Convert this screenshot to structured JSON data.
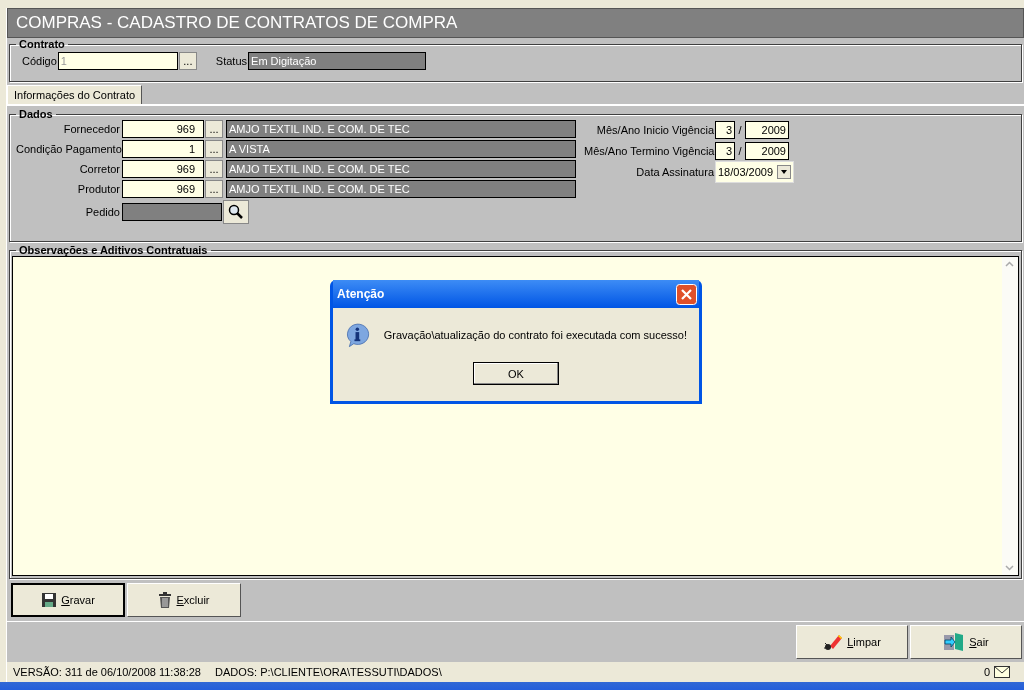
{
  "title": "COMPRAS - CADASTRO DE CONTRATOS DE COMPRA",
  "contrato": {
    "legend": "Contrato",
    "codigo_label": "Código",
    "codigo_value": "1",
    "lookup": "...",
    "status_label": "Status",
    "status_value": "Em Digitação"
  },
  "tabs": [
    {
      "label": "Informações do Contrato",
      "selected": true
    }
  ],
  "dados": {
    "legend": "Dados",
    "lookups": [
      {
        "label": "Fornecedor",
        "code": "969",
        "button": "...",
        "description": "AMJO TEXTIL IND. E COM. DE TEC"
      },
      {
        "label": "Condição Pagamento",
        "code": "1",
        "button": "...",
        "description": "A VISTA"
      },
      {
        "label": "Corretor",
        "code": "969",
        "button": "...",
        "description": "AMJO TEXTIL IND. E COM. DE TEC"
      },
      {
        "label": "Produtor",
        "code": "969",
        "button": "...",
        "description": "AMJO TEXTIL IND. E COM. DE TEC"
      }
    ],
    "pedido_label": "Pedido",
    "periods": [
      {
        "label": "Mês/Ano Inicio Vigência",
        "month": "3",
        "separator": "/",
        "year": "2009"
      },
      {
        "label": "Mês/Ano Termino Vigência",
        "month": "3",
        "separator": "/",
        "year": "2009"
      }
    ],
    "signature": {
      "label": "Data Assinatura",
      "value": "18/03/2009"
    }
  },
  "observacoes": {
    "legend": "Observações e Aditivos Contratuais"
  },
  "actions": [
    {
      "label": "Gravar",
      "kind": "save",
      "focused": true
    },
    {
      "label": "Excluir",
      "kind": "trash",
      "focused": false
    }
  ],
  "bottom_actions": [
    {
      "label": "Limpar",
      "kind": "eraser"
    },
    {
      "label": "Sair",
      "kind": "exit"
    }
  ],
  "status_bar": {
    "version": "VERSÃO: 311 de 06/10/2008 11:38:28",
    "data": "DADOS: P:\\CLIENTE\\ORA\\TESSUTI\\DADOS\\",
    "messages": "0"
  },
  "dialog": {
    "title": "Atenção",
    "message": "Gravação\\atualização do contrato foi executada com sucesso!",
    "button": "OK"
  }
}
